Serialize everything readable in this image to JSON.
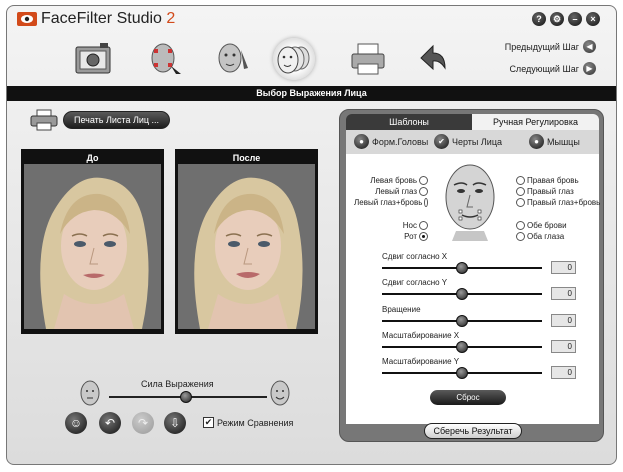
{
  "app": {
    "title": "FaceFilter Studio",
    "version": "2"
  },
  "window_controls": {
    "help": "?",
    "settings": "⚙",
    "minimize": "–",
    "close": "×"
  },
  "toolbar": {
    "tools": [
      "camera-icon",
      "face-select-icon",
      "face-edit-icon",
      "faces-expression-icon",
      "printer-icon",
      "undo-arrow-icon"
    ]
  },
  "nav": {
    "prev_label": "Предыдущий Шаг",
    "next_label": "Следующий Шаг"
  },
  "step_title": "Выбор Выражения Лица",
  "print_button": "Печать Листа Лиц ...",
  "before_label": "До",
  "after_label": "После",
  "strength_label": "Сила Выражения",
  "compare_label": "Режим Сравнения",
  "tabs": {
    "templates": "Шаблоны",
    "manual": "Ручная Регулировка"
  },
  "subtabs": {
    "head_shape": "Форм.Головы",
    "face_features": "Черты Лица",
    "muscles": "Мышцы"
  },
  "features_left": [
    "Левая бровь",
    "Левый глаз",
    "Левый глаз+бровь",
    "Нос",
    "Рот"
  ],
  "features_right": [
    "Правая бровь",
    "Правый глаз",
    "Правый глаз+бровь",
    "Обе брови",
    "Оба глаза"
  ],
  "selected_feature": "Рот",
  "sliders": [
    {
      "label": "Сдвиг согласно X",
      "value": "0"
    },
    {
      "label": "Сдвиг согласно Y",
      "value": "0"
    },
    {
      "label": "Вращение",
      "value": "0"
    },
    {
      "label": "Масштабирование X",
      "value": "0"
    },
    {
      "label": "Масштабирование Y",
      "value": "0"
    }
  ],
  "reset_button": "Сброс",
  "save_button": "Сберечь Результат",
  "colors": {
    "accent": "#d24a1a",
    "dark": "#111111",
    "panel": "#777777"
  }
}
